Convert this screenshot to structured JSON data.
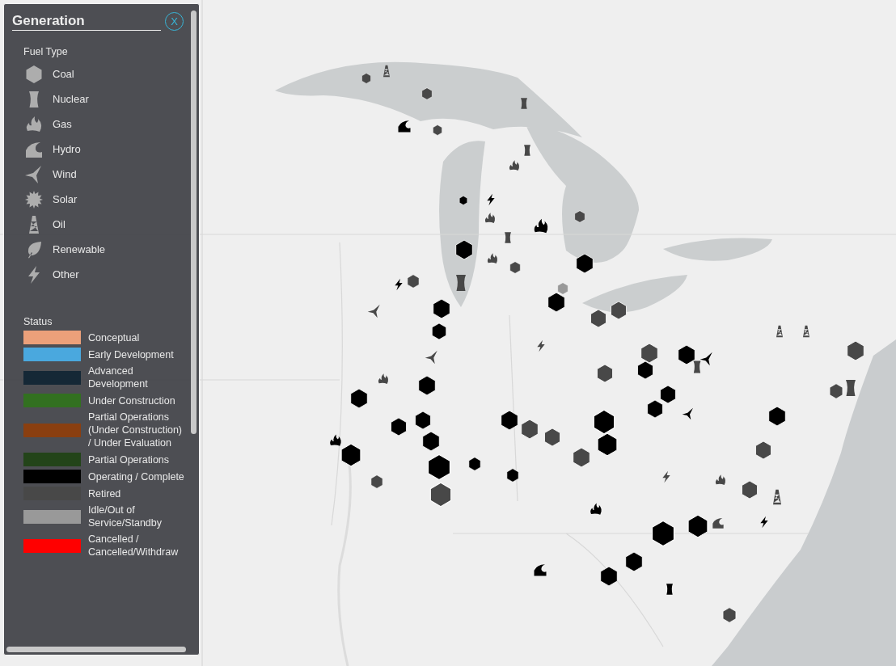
{
  "legend": {
    "title": "Generation",
    "close_label": "X",
    "fuel_heading": "Fuel Type",
    "fuel_types": [
      {
        "label": "Coal",
        "kind": "coal"
      },
      {
        "label": "Nuclear",
        "kind": "nuclear"
      },
      {
        "label": "Gas",
        "kind": "gas"
      },
      {
        "label": "Hydro",
        "kind": "hydro"
      },
      {
        "label": "Wind",
        "kind": "wind"
      },
      {
        "label": "Solar",
        "kind": "solar"
      },
      {
        "label": "Oil",
        "kind": "oil"
      },
      {
        "label": "Renewable",
        "kind": "renewable"
      },
      {
        "label": "Other",
        "kind": "other"
      }
    ],
    "status_heading": "Status",
    "statuses": [
      {
        "label": "Conceptual",
        "color": "#eba07a"
      },
      {
        "label": "Early Development",
        "color": "#4aa8de"
      },
      {
        "label": "Advanced Development",
        "color": "#152836"
      },
      {
        "label": "Under Construction",
        "color": "#327020"
      },
      {
        "label": "Partial Operations (Under Construction) / Under Evaluation",
        "color": "#8a3f10"
      },
      {
        "label": "Partial Operations",
        "color": "#234419"
      },
      {
        "label": "Operating / Complete",
        "color": "#000000"
      },
      {
        "label": "Retired",
        "color": "#484848"
      },
      {
        "label": "Idle/Out of Service/Standby",
        "color": "#999999"
      },
      {
        "label": "Cancelled / Cancelled/Withdraw",
        "color": "#ff0000"
      }
    ]
  },
  "map": {
    "kind": "picture",
    "markers": [
      {
        "kind": "coal",
        "color": "#000000"
      },
      {
        "kind": "coal",
        "color": "#000000"
      },
      {
        "kind": "coal",
        "color": "#000000"
      },
      {
        "kind": "coal",
        "color": "#000000"
      },
      {
        "kind": "coal",
        "color": "#000000"
      },
      {
        "kind": "coal",
        "color": "#000000"
      },
      {
        "kind": "coal",
        "color": "#000000"
      },
      {
        "kind": "coal",
        "color": "#000000"
      },
      {
        "kind": "coal",
        "color": "#000000"
      },
      {
        "kind": "coal",
        "color": "#000000"
      },
      {
        "kind": "coal",
        "color": "#000000"
      },
      {
        "kind": "coal",
        "color": "#000000"
      },
      {
        "kind": "coal",
        "color": "#000000"
      },
      {
        "kind": "coal",
        "color": "#000000"
      },
      {
        "kind": "coal",
        "color": "#000000"
      },
      {
        "kind": "coal",
        "color": "#000000"
      },
      {
        "kind": "coal",
        "color": "#000000"
      },
      {
        "kind": "coal",
        "color": "#000000"
      },
      {
        "kind": "coal",
        "color": "#000000"
      },
      {
        "kind": "coal",
        "color": "#000000"
      },
      {
        "kind": "coal",
        "color": "#000000"
      },
      {
        "kind": "coal",
        "color": "#000000"
      },
      {
        "kind": "coal",
        "color": "#000000"
      },
      {
        "kind": "coal",
        "color": "#000000"
      },
      {
        "kind": "coal",
        "color": "#000000"
      },
      {
        "kind": "coal",
        "color": "#000000"
      },
      {
        "kind": "coal",
        "color": "#000000"
      },
      {
        "kind": "coal",
        "color": "#484848"
      },
      {
        "kind": "coal",
        "color": "#484848"
      },
      {
        "kind": "coal",
        "color": "#484848"
      },
      {
        "kind": "coal",
        "color": "#484848"
      },
      {
        "kind": "coal",
        "color": "#484848"
      },
      {
        "kind": "coal",
        "color": "#484848"
      },
      {
        "kind": "coal",
        "color": "#484848"
      },
      {
        "kind": "coal",
        "color": "#484848"
      },
      {
        "kind": "coal",
        "color": "#484848"
      },
      {
        "kind": "coal",
        "color": "#484848"
      },
      {
        "kind": "coal",
        "color": "#484848"
      },
      {
        "kind": "coal",
        "color": "#484848"
      },
      {
        "kind": "coal",
        "color": "#484848"
      },
      {
        "kind": "coal",
        "color": "#484848"
      },
      {
        "kind": "coal",
        "color": "#484848"
      },
      {
        "kind": "coal",
        "color": "#484848"
      },
      {
        "kind": "coal",
        "color": "#484848"
      },
      {
        "kind": "coal",
        "color": "#484848"
      },
      {
        "kind": "coal",
        "color": "#484848"
      },
      {
        "kind": "coal",
        "color": "#484848"
      },
      {
        "kind": "coal",
        "color": "#999999"
      },
      {
        "kind": "nuclear",
        "color": "#484848"
      },
      {
        "kind": "nuclear",
        "color": "#484848"
      },
      {
        "kind": "nuclear",
        "color": "#484848"
      },
      {
        "kind": "nuclear",
        "color": "#484848"
      },
      {
        "kind": "nuclear",
        "color": "#484848"
      },
      {
        "kind": "nuclear",
        "color": "#484848"
      },
      {
        "kind": "nuclear",
        "color": "#000000"
      },
      {
        "kind": "gas",
        "color": "#000000"
      },
      {
        "kind": "gas",
        "color": "#484848"
      },
      {
        "kind": "gas",
        "color": "#484848"
      },
      {
        "kind": "gas",
        "color": "#484848"
      },
      {
        "kind": "gas",
        "color": "#000000"
      },
      {
        "kind": "gas",
        "color": "#000000"
      },
      {
        "kind": "gas",
        "color": "#484848"
      },
      {
        "kind": "gas",
        "color": "#484848"
      },
      {
        "kind": "oil",
        "color": "#484848"
      },
      {
        "kind": "oil",
        "color": "#484848"
      },
      {
        "kind": "oil",
        "color": "#484848"
      },
      {
        "kind": "oil",
        "color": "#484848"
      },
      {
        "kind": "wind",
        "color": "#484848"
      },
      {
        "kind": "wind",
        "color": "#484848"
      },
      {
        "kind": "wind",
        "color": "#000000"
      },
      {
        "kind": "wind",
        "color": "#000000"
      },
      {
        "kind": "other",
        "color": "#000000"
      },
      {
        "kind": "other",
        "color": "#000000"
      },
      {
        "kind": "other",
        "color": "#484848"
      },
      {
        "kind": "other",
        "color": "#484848"
      },
      {
        "kind": "other",
        "color": "#000000"
      },
      {
        "kind": "hydro",
        "color": "#000000"
      },
      {
        "kind": "hydro",
        "color": "#000000"
      },
      {
        "kind": "hydro",
        "color": "#484848"
      }
    ]
  }
}
